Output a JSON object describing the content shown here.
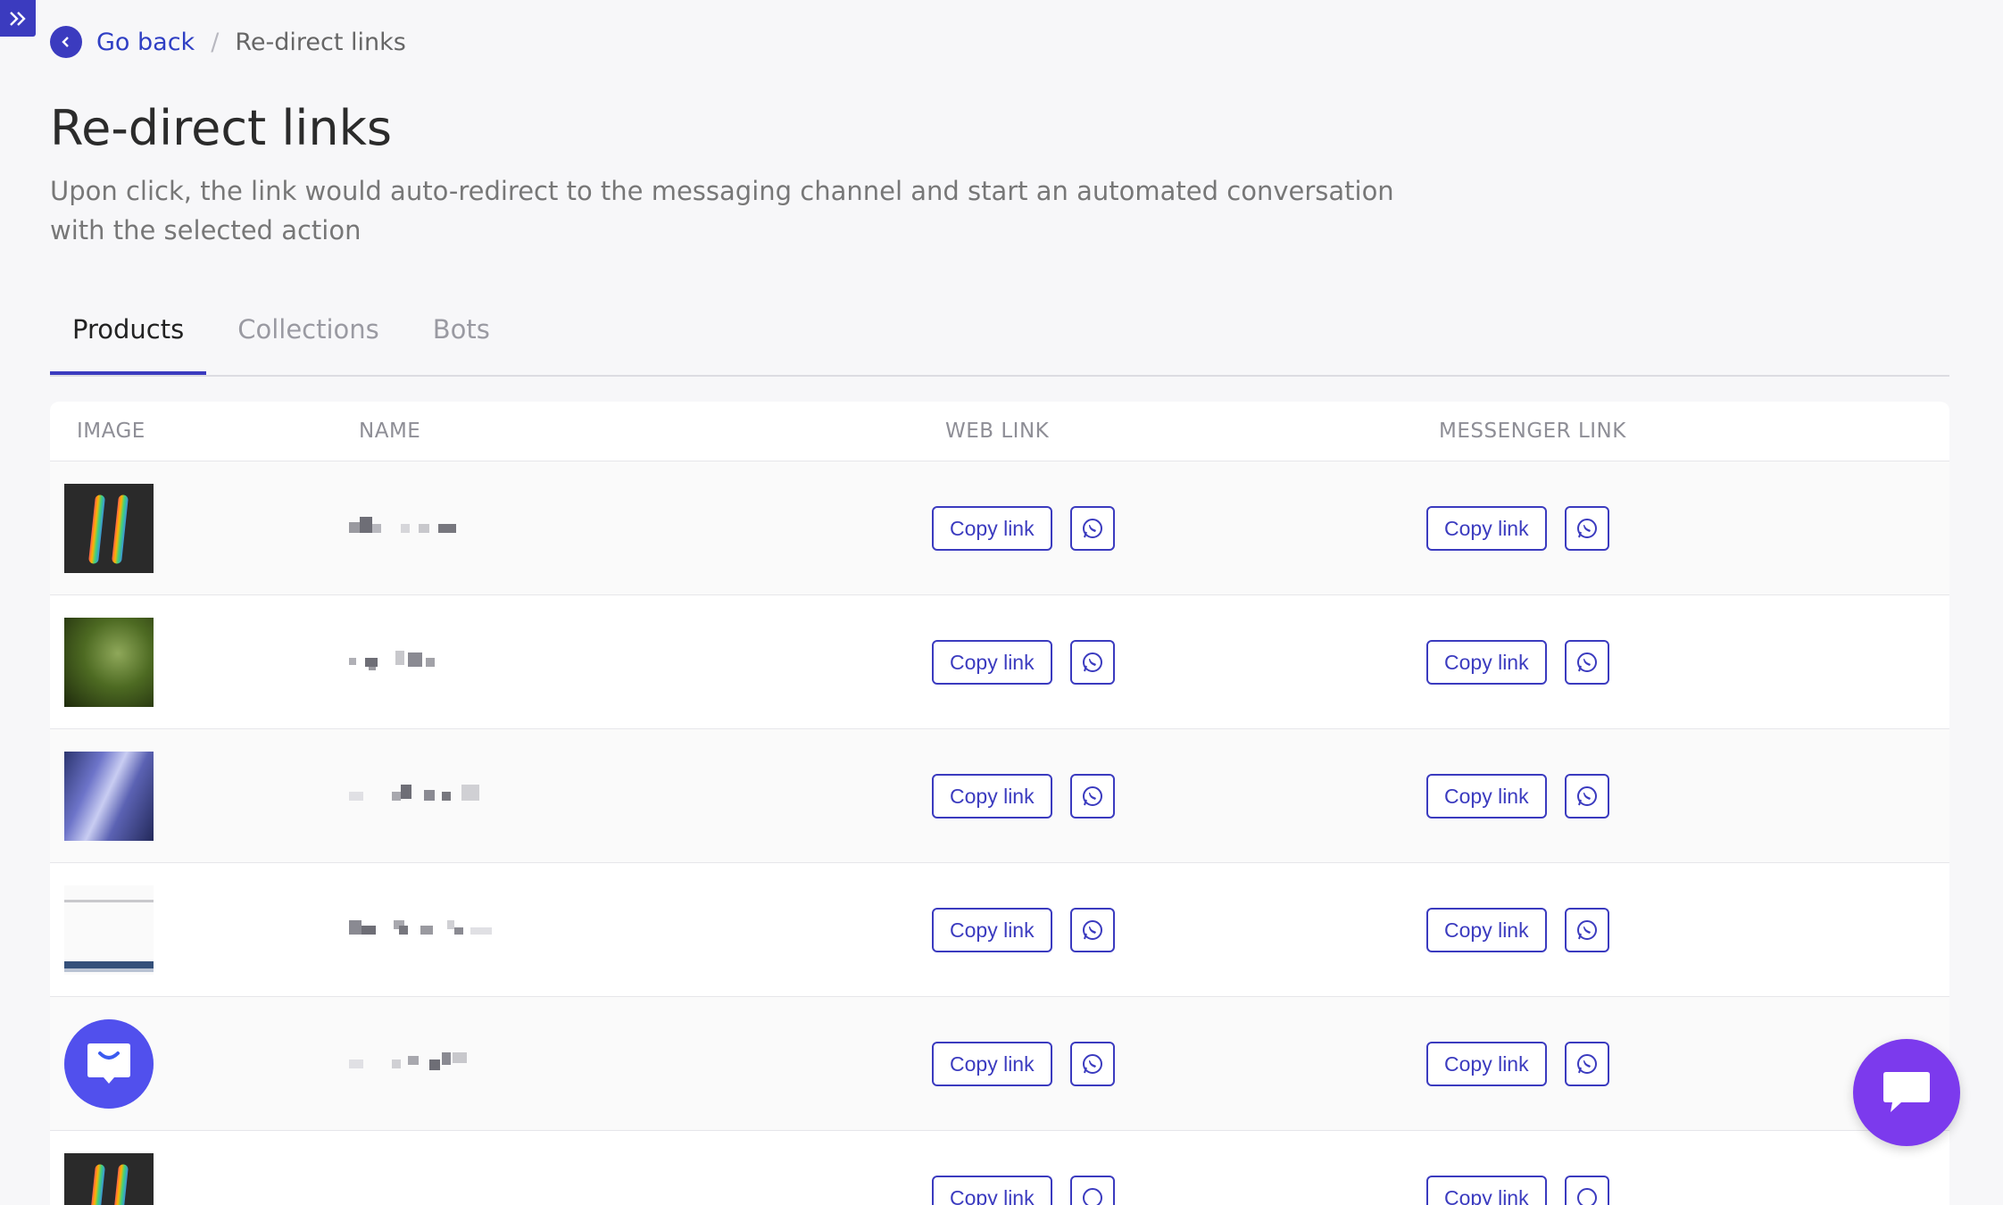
{
  "nav": {
    "back_label": "Go back",
    "separator": "/",
    "current": "Re-direct links"
  },
  "page": {
    "title": "Re-direct links",
    "description": "Upon click, the link would auto-redirect to the messaging channel and start an automated conversation with the selected action"
  },
  "tabs": [
    {
      "label": "Products",
      "active": true
    },
    {
      "label": "Collections",
      "active": false
    },
    {
      "label": "Bots",
      "active": false
    }
  ],
  "table": {
    "headers": {
      "image": "IMAGE",
      "name": "NAME",
      "web_link": "WEB LINK",
      "messenger_link": "MESSENGER LINK"
    },
    "copy_label": "Copy link",
    "rows": [
      {
        "image": "hashtag-image"
      },
      {
        "image": "leaf-image"
      },
      {
        "image": "wave-image"
      },
      {
        "image": "device-image"
      },
      {
        "image": "chat-app-image"
      },
      {
        "image": "hashtag-image"
      }
    ]
  },
  "colors": {
    "accent": "#3b3bbf",
    "fab": "#7c3aed",
    "link": "#2f3fc4"
  }
}
